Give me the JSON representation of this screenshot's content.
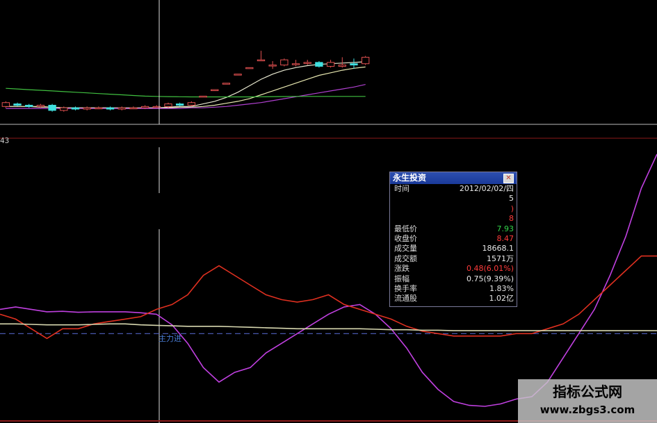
{
  "top_left_value": "43",
  "signal_label": "主力进",
  "info_panel": {
    "title": "永生投资",
    "close_glyph": "✕",
    "rows": [
      {
        "label": "时间",
        "value": "2012/02/02/四",
        "color": "white"
      },
      {
        "label": "",
        "value": "5",
        "color": "white"
      },
      {
        "label": "",
        "value": ")",
        "color": "red"
      },
      {
        "label": "",
        "value": "8",
        "color": "red"
      },
      {
        "label": "最低价",
        "value": "7.93",
        "color": "green"
      },
      {
        "label": "收盘价",
        "value": "8.47",
        "color": "red"
      },
      {
        "label": "成交量",
        "value": "18668.1",
        "color": "white"
      },
      {
        "label": "成交额",
        "value": "1571万",
        "color": "white"
      },
      {
        "label": "涨跌",
        "value": "0.48(6.01%)",
        "color": "red"
      },
      {
        "label": "振幅",
        "value": "0.75(9.39%)",
        "color": "white"
      },
      {
        "label": "换手率",
        "value": "1.83%",
        "color": "white"
      },
      {
        "label": "流通股",
        "value": "1.02亿",
        "color": "white"
      }
    ]
  },
  "watermark": {
    "line1": "指标公式网",
    "line2": "www.zbgs3.com"
  },
  "colors": {
    "background": "#000000",
    "magenta": "#c040e0",
    "red": "#e03020",
    "pale": "#d8d8b0",
    "green": "#40c040",
    "candle_up": "#e05050",
    "candle_down": "#40e0e0",
    "dashed": "#5060c0",
    "divider": "#8b1a1a"
  },
  "chart_data": [
    {
      "type": "candlestick",
      "title": "",
      "candles": [
        {
          "o": 12.6,
          "c": 12.9,
          "h": 13.0,
          "l": 12.5
        },
        {
          "o": 12.8,
          "c": 12.7,
          "h": 12.9,
          "l": 12.6
        },
        {
          "o": 12.7,
          "c": 12.6,
          "h": 12.8,
          "l": 12.5
        },
        {
          "o": 12.6,
          "c": 12.7,
          "h": 12.8,
          "l": 12.5
        },
        {
          "o": 12.7,
          "c": 12.3,
          "h": 12.8,
          "l": 12.2
        },
        {
          "o": 12.3,
          "c": 12.5,
          "h": 12.6,
          "l": 12.2
        },
        {
          "o": 12.5,
          "c": 12.4,
          "h": 12.6,
          "l": 12.3
        },
        {
          "o": 12.4,
          "c": 12.5,
          "h": 12.6,
          "l": 12.3
        },
        {
          "o": 12.5,
          "c": 12.5,
          "h": 12.6,
          "l": 12.4
        },
        {
          "o": 12.5,
          "c": 12.4,
          "h": 12.6,
          "l": 12.3
        },
        {
          "o": 12.4,
          "c": 12.5,
          "h": 12.6,
          "l": 12.3
        },
        {
          "o": 12.5,
          "c": 12.5,
          "h": 12.6,
          "l": 12.4
        },
        {
          "o": 12.5,
          "c": 12.6,
          "h": 12.7,
          "l": 12.4
        },
        {
          "o": 12.6,
          "c": 12.6,
          "h": 12.7,
          "l": 12.5
        },
        {
          "o": 12.6,
          "c": 12.8,
          "h": 12.9,
          "l": 12.5
        },
        {
          "o": 12.8,
          "c": 12.7,
          "h": 12.9,
          "l": 12.6
        },
        {
          "o": 12.7,
          "c": 12.9,
          "h": 13.0,
          "l": 12.6
        },
        {
          "o": 13.4,
          "c": 13.4,
          "h": 13.4,
          "l": 13.4
        },
        {
          "o": 13.9,
          "c": 13.9,
          "h": 13.9,
          "l": 13.9
        },
        {
          "o": 14.4,
          "c": 14.4,
          "h": 14.4,
          "l": 14.4
        },
        {
          "o": 15.1,
          "c": 15.1,
          "h": 15.1,
          "l": 15.1
        },
        {
          "o": 15.6,
          "c": 15.6,
          "h": 15.6,
          "l": 15.6
        },
        {
          "o": 16.2,
          "c": 16.2,
          "h": 16.9,
          "l": 16.2
        },
        {
          "o": 15.8,
          "c": 15.8,
          "h": 16.1,
          "l": 15.5
        },
        {
          "o": 15.8,
          "c": 16.2,
          "h": 16.3,
          "l": 15.7
        },
        {
          "o": 15.9,
          "c": 15.9,
          "h": 16.2,
          "l": 15.7
        },
        {
          "o": 16.0,
          "c": 16.0,
          "h": 16.2,
          "l": 15.8
        },
        {
          "o": 16.0,
          "c": 15.7,
          "h": 16.1,
          "l": 15.6
        },
        {
          "o": 15.7,
          "c": 16.0,
          "h": 16.2,
          "l": 15.6
        },
        {
          "o": 15.7,
          "c": 15.8,
          "h": 16.4,
          "l": 15.6
        },
        {
          "o": 15.9,
          "c": 15.8,
          "h": 16.3,
          "l": 15.5
        },
        {
          "o": 15.9,
          "c": 16.4,
          "h": 16.5,
          "l": 15.8
        }
      ],
      "ma_series": [
        {
          "color": "#e8e8d0",
          "values": [
            12.6,
            12.6,
            12.6,
            12.6,
            12.55,
            12.5,
            12.5,
            12.5,
            12.5,
            12.5,
            12.45,
            12.45,
            12.5,
            12.5,
            12.55,
            12.6,
            12.6,
            12.8,
            13.0,
            13.3,
            13.7,
            14.2,
            14.7,
            15.1,
            15.4,
            15.6,
            15.75,
            15.85,
            15.9,
            15.95,
            16.0,
            16.05
          ]
        },
        {
          "color": "#e8e8b0",
          "values": [
            12.6,
            12.6,
            12.6,
            12.55,
            12.55,
            12.5,
            12.5,
            12.5,
            12.5,
            12.5,
            12.5,
            12.5,
            12.5,
            12.5,
            12.5,
            12.55,
            12.55,
            12.6,
            12.7,
            12.85,
            13.0,
            13.2,
            13.5,
            13.8,
            14.1,
            14.4,
            14.7,
            15.0,
            15.2,
            15.4,
            15.55,
            15.65
          ]
        },
        {
          "color": "#b040d0",
          "values": [
            12.45,
            12.45,
            12.45,
            12.45,
            12.45,
            12.45,
            12.45,
            12.45,
            12.45,
            12.45,
            12.45,
            12.45,
            12.45,
            12.45,
            12.45,
            12.45,
            12.5,
            12.5,
            12.55,
            12.6,
            12.7,
            12.8,
            12.9,
            13.05,
            13.2,
            13.35,
            13.5,
            13.65,
            13.8,
            13.95,
            14.1,
            14.3
          ]
        },
        {
          "color": "#40c040",
          "values": [
            14.0,
            13.95,
            13.9,
            13.85,
            13.8,
            13.75,
            13.7,
            13.65,
            13.6,
            13.55,
            13.5,
            13.45,
            13.4,
            13.38,
            13.36,
            13.35,
            13.34,
            13.34,
            13.34,
            13.34,
            13.34,
            13.34,
            13.35,
            13.36,
            13.37,
            13.38,
            13.38,
            13.38,
            13.38,
            13.38,
            13.38,
            13.38
          ]
        }
      ],
      "ylim": [
        11.6,
        17.6
      ]
    },
    {
      "type": "line",
      "title": "",
      "series": [
        {
          "color": "#c040e0",
          "values": [
            0.5,
            0.55,
            0.5,
            0.45,
            0.46,
            0.44,
            0.45,
            0.45,
            0.45,
            0.43,
            0.4,
            0.18,
            -0.2,
            -0.7,
            -1.0,
            -0.8,
            -0.7,
            -0.4,
            -0.2,
            0.0,
            0.2,
            0.4,
            0.55,
            0.6,
            0.4,
            0.1,
            -0.3,
            -0.8,
            -1.15,
            -1.4,
            -1.48,
            -1.5,
            -1.45,
            -1.35,
            -1.3,
            -1.0,
            -0.5,
            0.0,
            0.5,
            1.2,
            2.0,
            3.0,
            3.7
          ]
        },
        {
          "color": "#e03020",
          "values": [
            0.4,
            0.3,
            0.1,
            -0.1,
            0.1,
            0.1,
            0.2,
            0.25,
            0.3,
            0.35,
            0.5,
            0.6,
            0.8,
            1.2,
            1.4,
            1.2,
            1.0,
            0.8,
            0.7,
            0.65,
            0.7,
            0.8,
            0.6,
            0.5,
            0.4,
            0.3,
            0.15,
            0.05,
            0.0,
            -0.05,
            -0.05,
            -0.05,
            -0.05,
            0.0,
            0.0,
            0.1,
            0.2,
            0.4,
            0.7,
            1.0,
            1.3,
            1.6,
            1.6
          ]
        },
        {
          "color": "#d8d8b0",
          "values": [
            0.2,
            0.2,
            0.19,
            0.18,
            0.18,
            0.18,
            0.19,
            0.2,
            0.2,
            0.18,
            0.17,
            0.16,
            0.15,
            0.15,
            0.15,
            0.14,
            0.13,
            0.12,
            0.11,
            0.1,
            0.1,
            0.1,
            0.1,
            0.1,
            0.09,
            0.08,
            0.08,
            0.07,
            0.07,
            0.06,
            0.06,
            0.06,
            0.06,
            0.06,
            0.06,
            0.06,
            0.06,
            0.06,
            0.06,
            0.06,
            0.06,
            0.06,
            0.06
          ]
        }
      ],
      "zero_line": 0,
      "ylim": [
        -1.6,
        3.8
      ]
    }
  ]
}
